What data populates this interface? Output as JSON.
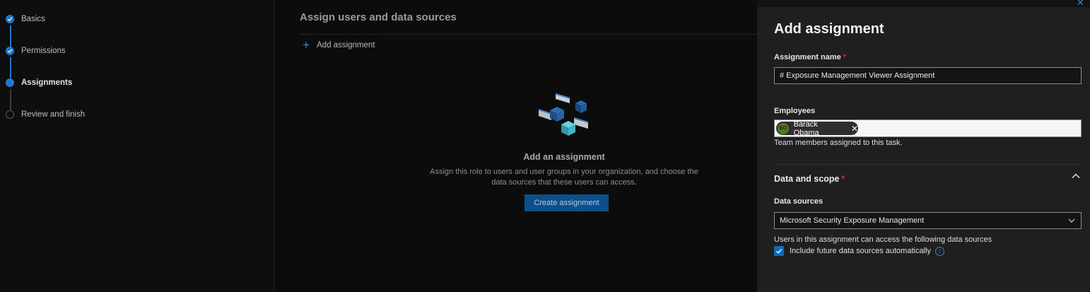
{
  "stepper": {
    "steps": [
      {
        "label": "Basics",
        "state": "done"
      },
      {
        "label": "Permissions",
        "state": "done"
      },
      {
        "label": "Assignments",
        "state": "current"
      },
      {
        "label": "Review and finish",
        "state": "todo"
      }
    ]
  },
  "main": {
    "title": "Assign users and data sources",
    "add_assignment_label": "Add assignment",
    "empty_state": {
      "title": "Add an assignment",
      "description": "Assign this role to users and user groups in your organization, and choose the data sources that these users can access.",
      "button_label": "Create assignment"
    }
  },
  "panel": {
    "title": "Add assignment",
    "assignment_name": {
      "label": "Assignment name",
      "required_mark": "*",
      "value": "# Exposure Management Viewer Assignment"
    },
    "employees": {
      "label": "Employees",
      "chip_initials": "BO",
      "chip_name": "Barack Obama",
      "chip_remove": "✕",
      "helper": "Team members assigned to this task."
    },
    "data_scope": {
      "title": "Data and scope",
      "required_mark": "*",
      "data_sources_label": "Data sources",
      "selected_source": "Microsoft Security Exposure Management",
      "helper": "Users in this assignment can access the following data sources",
      "include_future_label": "Include future data sources automatically",
      "include_future_checked": true,
      "info_glyph": "i"
    },
    "close_glyph": "✕"
  },
  "colors": {
    "accent": "#2577c9",
    "button": "#0c4f8d",
    "required": "#d13438",
    "checkbox": "#0f6cbd"
  },
  "icons": [
    "check-icon",
    "plus-icon",
    "close-icon",
    "chevron-up-icon",
    "chevron-down-icon",
    "info-icon",
    "cubes-illustration"
  ]
}
